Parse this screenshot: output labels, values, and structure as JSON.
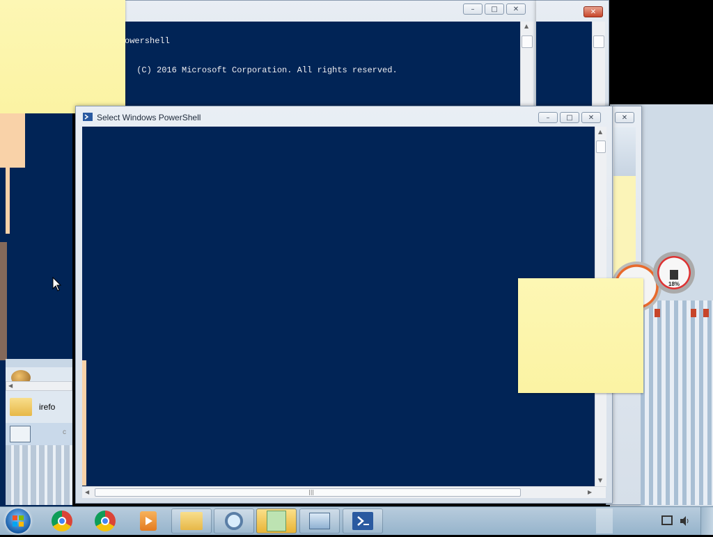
{
  "back_window": {
    "line1": "owershell",
    "line2": " (C) 2016 Microsoft Corporation. All rights reserved."
  },
  "front_window": {
    "title": "Select Windows PowerShell",
    "body_text": ""
  },
  "left_panel": {
    "item_label": "irefo",
    "partial_label": "c"
  },
  "gadget": {
    "percent": "18%"
  },
  "window_controls": {
    "minimize": "–",
    "maximize": "□",
    "close": "✕"
  },
  "taskbar": {
    "items": [
      "start",
      "chrome",
      "chrome",
      "media-player",
      "explorer",
      "search-tool",
      "sticky-notes",
      "computer",
      "powershell"
    ]
  },
  "colors": {
    "console_bg": "#012456",
    "console_fg": "#eeedf0",
    "sticky": "#fdf7b4",
    "taskbar": "#a9c2d6"
  }
}
